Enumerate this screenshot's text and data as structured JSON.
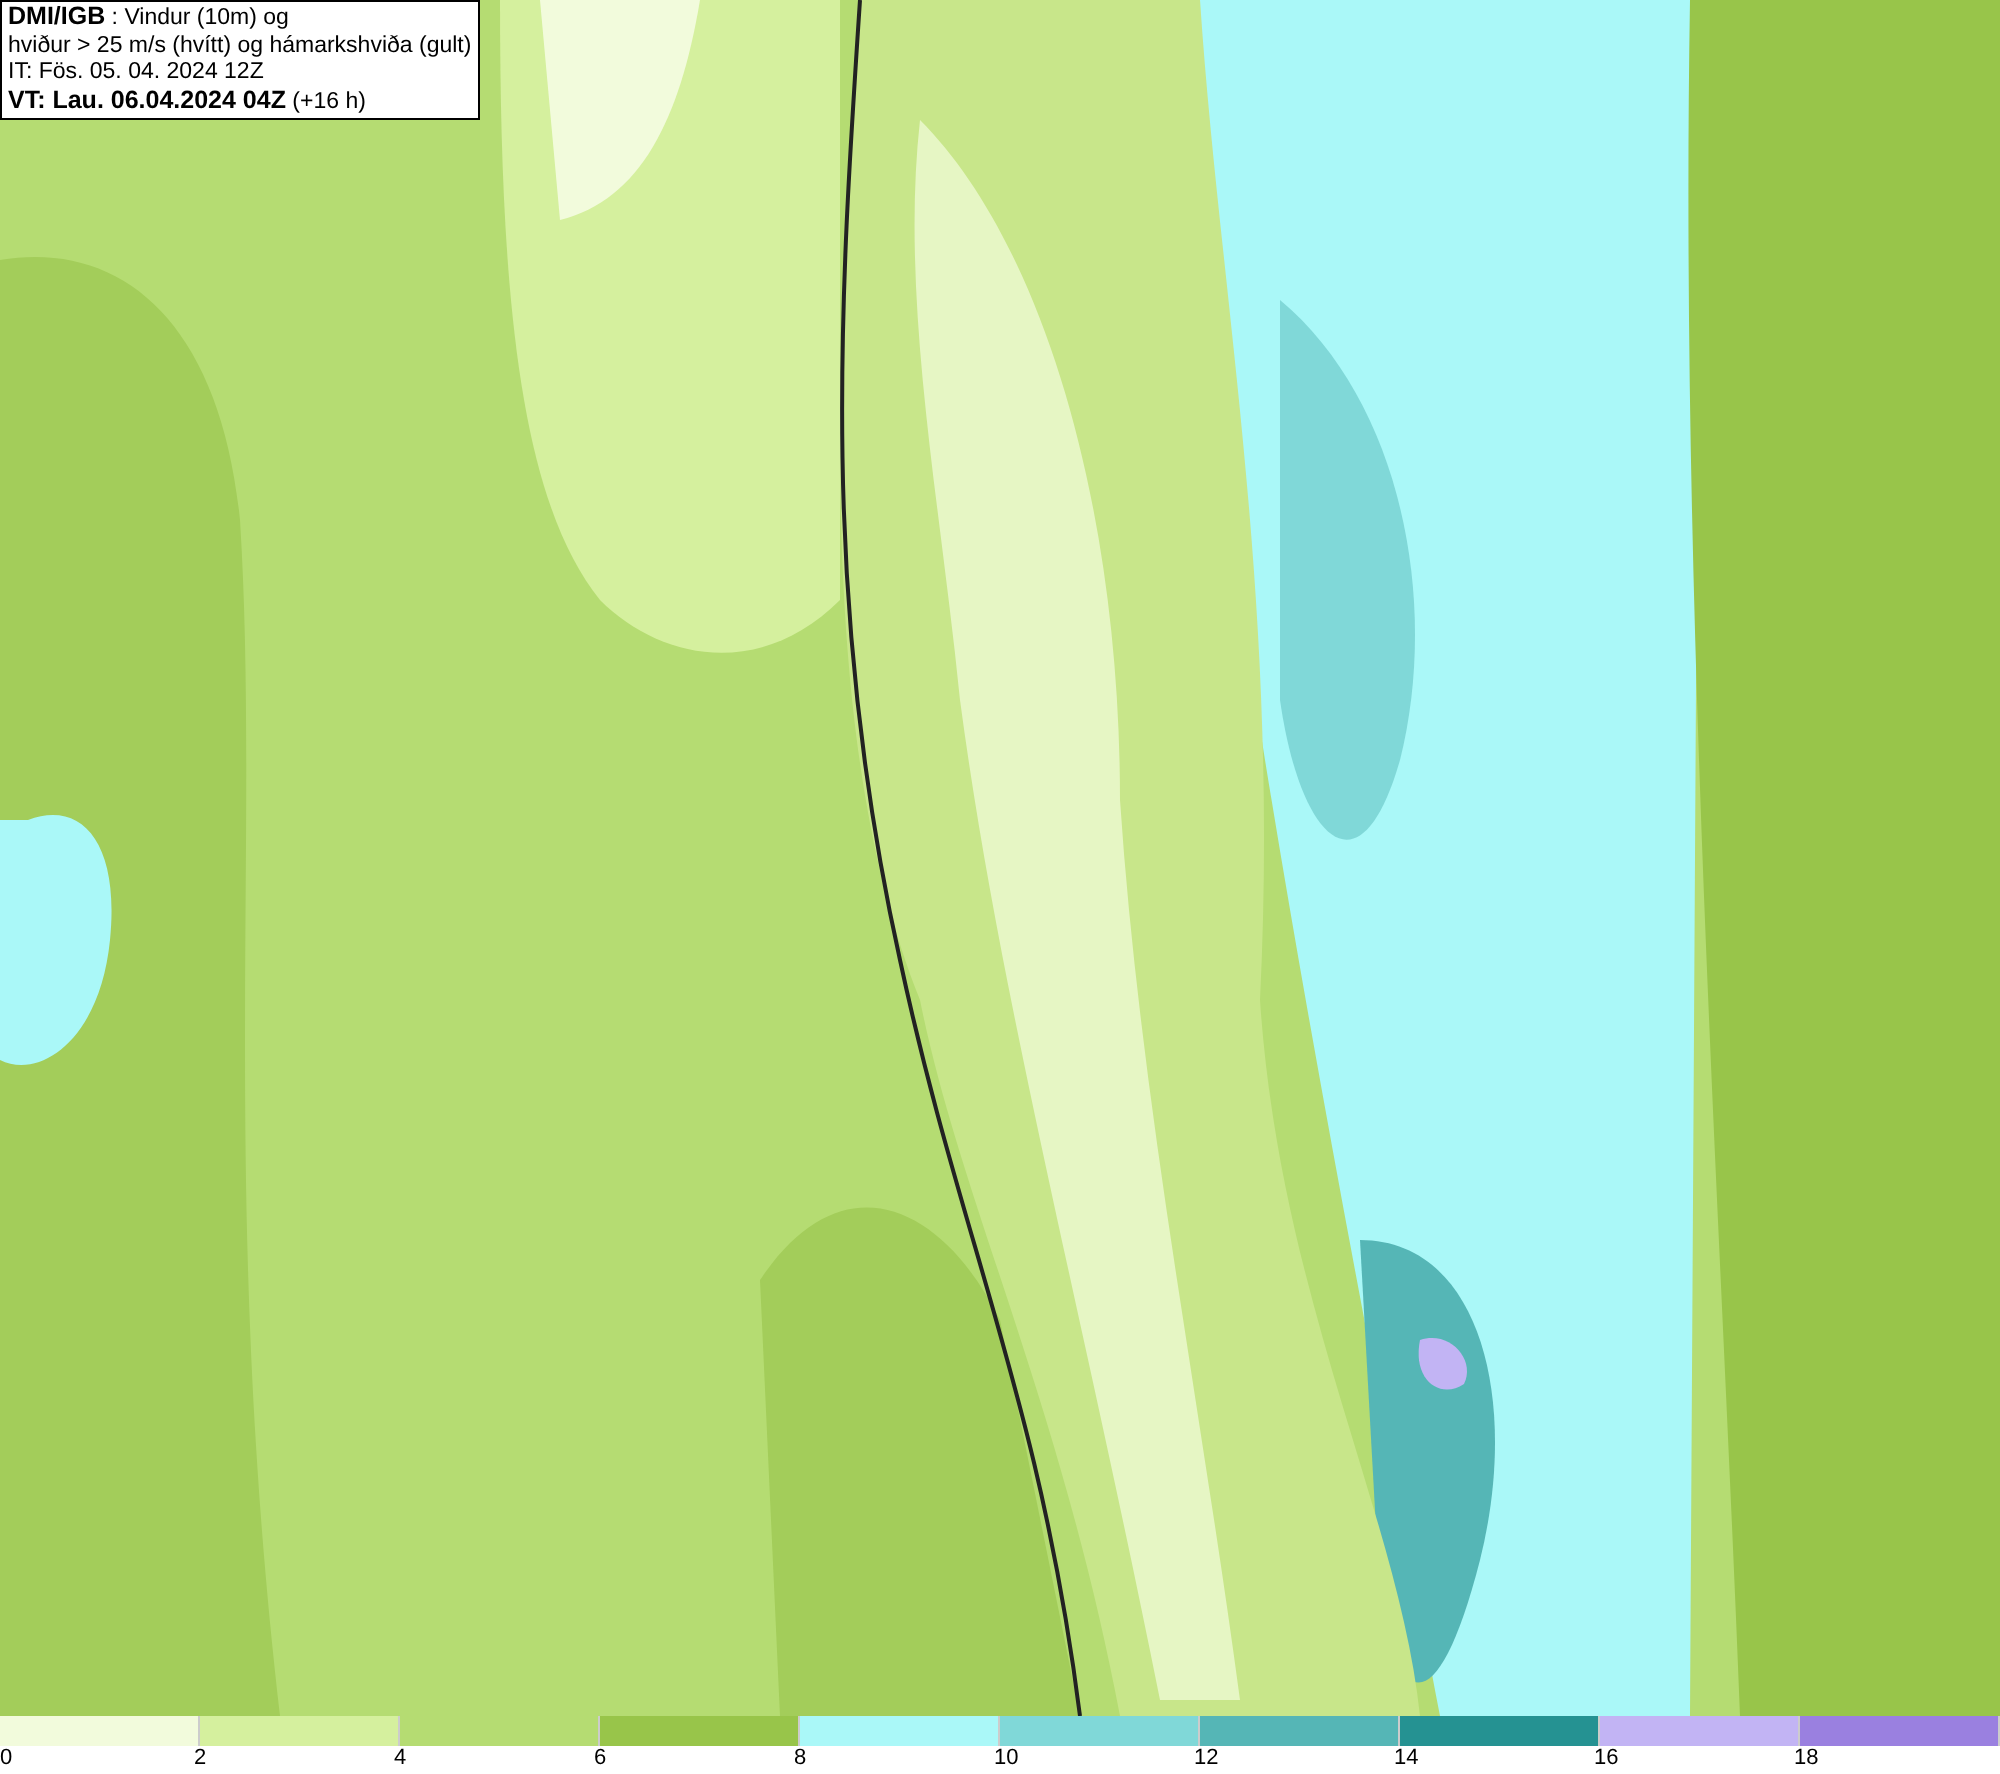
{
  "title_box": {
    "lines": [
      "**DMI/IGB** : Vindur (10m) og",
      "hviður > 25 m/s (hvítt) og hámarkshviða (gult)",
      "IT: Fös. 05. 04. 2024 12Z",
      "**VT: Lau. 06.04.2024 04Z** (+16 h)"
    ]
  },
  "legend": [
    {
      "label": "0",
      "color": "#f2fbdc"
    },
    {
      "label": "2",
      "color": "#d5f09e"
    },
    {
      "label": "4",
      "color": "#b5dc72"
    },
    {
      "label": "6",
      "color": "#98c54a"
    },
    {
      "label": "8",
      "color": "#aaf8f8"
    },
    {
      "label": "10",
      "color": "#80d8d8"
    },
    {
      "label": "12",
      "color": "#55b6b6"
    },
    {
      "label": "14",
      "color": "#259292"
    },
    {
      "label": "16",
      "color": "#c2b4f4"
    },
    {
      "label": "18",
      "color": "#9a80e0"
    }
  ]
}
